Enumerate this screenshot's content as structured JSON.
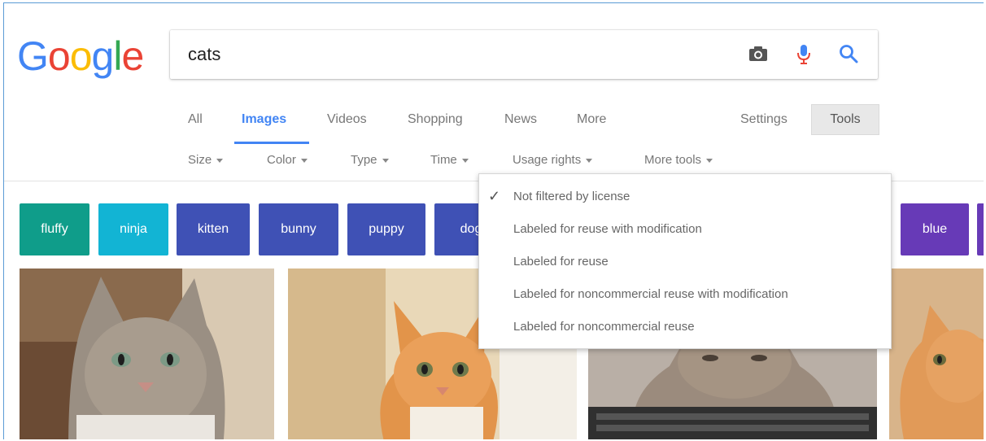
{
  "logo": {
    "letters": [
      "G",
      "o",
      "o",
      "g",
      "l",
      "e"
    ]
  },
  "search": {
    "query": "cats",
    "icons": [
      "camera-icon",
      "microphone-icon",
      "search-icon"
    ]
  },
  "tabs": [
    {
      "label": "All"
    },
    {
      "label": "Images",
      "active": true
    },
    {
      "label": "Videos"
    },
    {
      "label": "Shopping"
    },
    {
      "label": "News"
    },
    {
      "label": "More"
    }
  ],
  "settings_label": "Settings",
  "tools_label": "Tools",
  "filters": [
    {
      "label": "Size"
    },
    {
      "label": "Color"
    },
    {
      "label": "Type"
    },
    {
      "label": "Time"
    },
    {
      "label": "Usage rights"
    },
    {
      "label": "More tools"
    }
  ],
  "chips": [
    {
      "label": "fluffy",
      "color": "#0f9d8a"
    },
    {
      "label": "ninja",
      "color": "#12b4d4"
    },
    {
      "label": "kitten",
      "color": "#3f51b5"
    },
    {
      "label": "bunny",
      "color": "#3f51b5"
    },
    {
      "label": "puppy",
      "color": "#3f51b5"
    },
    {
      "label": "dog",
      "color": "#3f51b5"
    },
    {
      "label": "blue",
      "color": "#673ab7"
    }
  ],
  "usage_rights_menu": {
    "items": [
      {
        "label": "Not filtered by license",
        "selected": true
      },
      {
        "label": "Labeled for reuse with modification"
      },
      {
        "label": "Labeled for reuse"
      },
      {
        "label": "Labeled for noncommercial reuse with modification"
      },
      {
        "label": "Labeled for noncommercial reuse"
      }
    ]
  },
  "colors": {
    "accent": "#4285f4",
    "frame": "#5b9bd5"
  }
}
